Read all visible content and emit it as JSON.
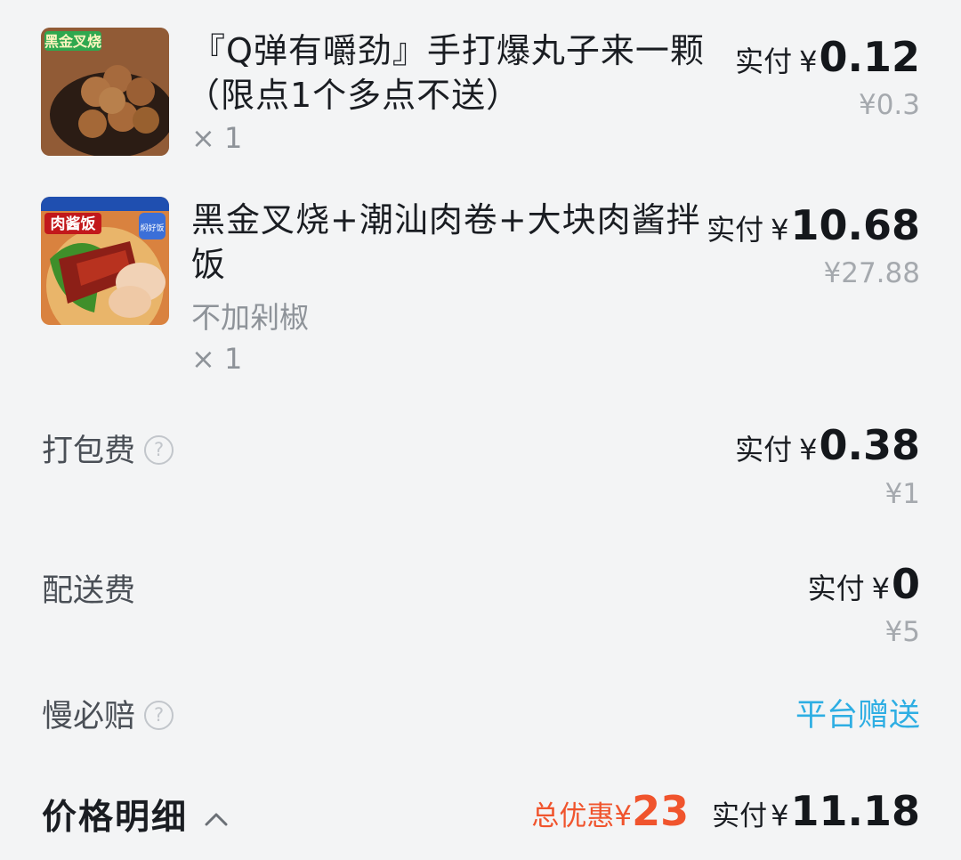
{
  "items": [
    {
      "title_line1": "『Q弹有嚼劲』手打爆丸子来一颗",
      "title_line2": "（限点1个多点不送）",
      "quantity": "× 1",
      "pay_label": "实付",
      "currency": "¥",
      "pay_amount": "0.12",
      "original_price": "¥0.3",
      "thumb_banner": "黑金叉烧",
      "thumb_icon": "meatball-food-photo"
    },
    {
      "title_line1": "黑金叉烧+潮汕肉卷+大块肉酱拌",
      "title_line2": "饭",
      "spec": "不加剁椒",
      "quantity": "× 1",
      "pay_label": "实付",
      "currency": "¥",
      "pay_amount": "10.68",
      "original_price": "¥27.88",
      "thumb_banner": "肉酱饭",
      "thumb_badge": "焖好饭",
      "thumb_icon": "charsiu-rice-food-photo"
    }
  ],
  "fees": {
    "packing": {
      "label": "打包费",
      "help_icon": "?",
      "pay_label": "实付",
      "currency": "¥",
      "pay_amount": "0.38",
      "original_price": "¥1"
    },
    "delivery": {
      "label": "配送费",
      "pay_label": "实付",
      "currency": "¥",
      "pay_amount": "0",
      "original_price": "¥5"
    },
    "late_compensation": {
      "label": "慢必赔",
      "help_icon": "?",
      "value": "平台赠送"
    }
  },
  "summary": {
    "title": "价格明细",
    "discount_label": "总优惠",
    "currency": "¥",
    "discount_amount": "23",
    "pay_label": "实付",
    "pay_amount": "11.18"
  },
  "colors": {
    "background": "#f3f4f5",
    "discount": "#f0542d",
    "gift": "#2eaee3",
    "muted": "#8e9399"
  }
}
